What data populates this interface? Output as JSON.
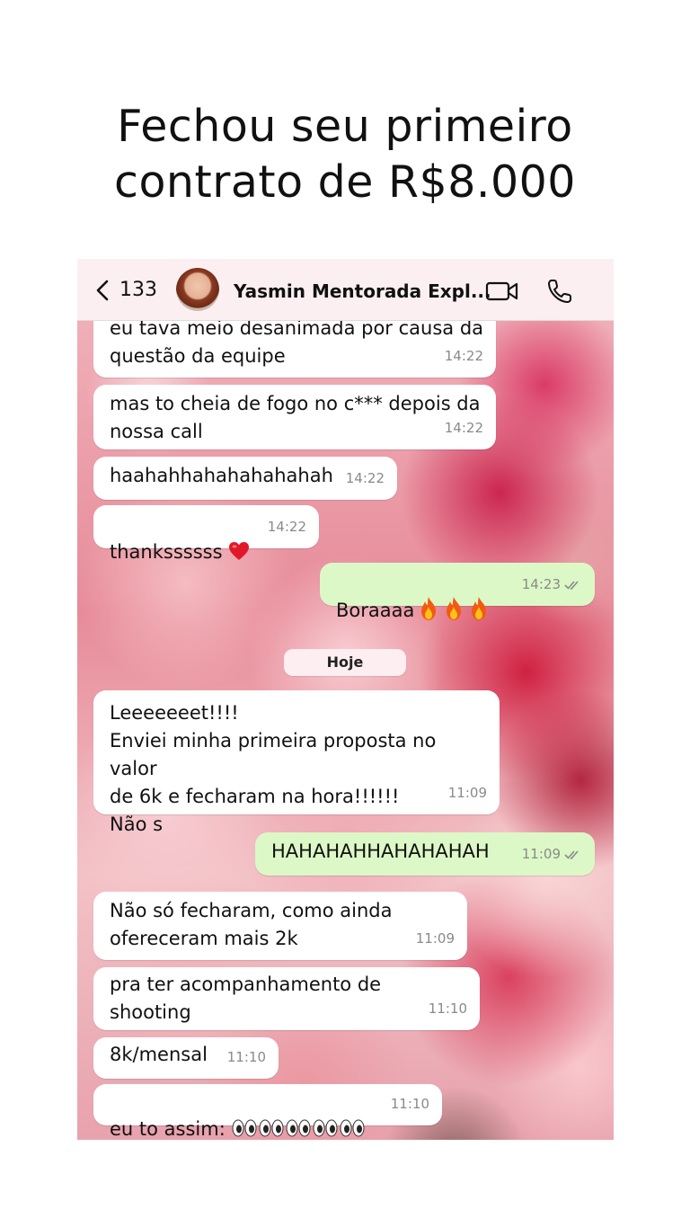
{
  "headline": {
    "line1": "Fechou seu primeiro",
    "line2": "contrato de R$8.000"
  },
  "header": {
    "unread_count": "133",
    "contact_name": "Yasmin Mentorada Expl..."
  },
  "date_separator": "Hoje",
  "messages": [
    {
      "text": "eu tava meio desanimada por causa da\nquestão da equipe",
      "time": "14:22",
      "direction": "in"
    },
    {
      "text": "mas to cheia de fogo no c*** depois da\nnossa call",
      "time": "14:22",
      "direction": "in"
    },
    {
      "text": "haahahhahahahahahah",
      "time": "14:22",
      "direction": "in"
    },
    {
      "text": "thankssssss",
      "time": "14:22",
      "direction": "in",
      "emoji": "red-heart"
    },
    {
      "text": "Boraaaa",
      "time": "14:23",
      "direction": "out",
      "emoji": "fire x3",
      "status": "read"
    },
    {
      "text": "Leeeeeeet!!!!\nEnviei minha primeira proposta no valor\nde 6k e fecharam na hora!!!!!!\nNão s",
      "time": "11:09",
      "direction": "in"
    },
    {
      "text": "HAHAHAHHAHAHAHAH",
      "time": "11:09",
      "direction": "out",
      "status": "read"
    },
    {
      "text": "Não só fecharam, como ainda\nofereceram mais 2k",
      "time": "11:09",
      "direction": "in"
    },
    {
      "text": "pra ter acompanhamento de shooting",
      "time": "11:10",
      "direction": "in"
    },
    {
      "text": "8k/mensal",
      "time": "11:10",
      "direction": "in"
    },
    {
      "text": "eu to assim:",
      "time": "11:10",
      "direction": "in",
      "emoji": "eyes x5"
    }
  ],
  "colors": {
    "incoming_bubble": "#ffffff",
    "outgoing_bubble": "#dcf8c6",
    "header_bg": "#fbeff2",
    "read_ticks": "#8a8a8a"
  }
}
